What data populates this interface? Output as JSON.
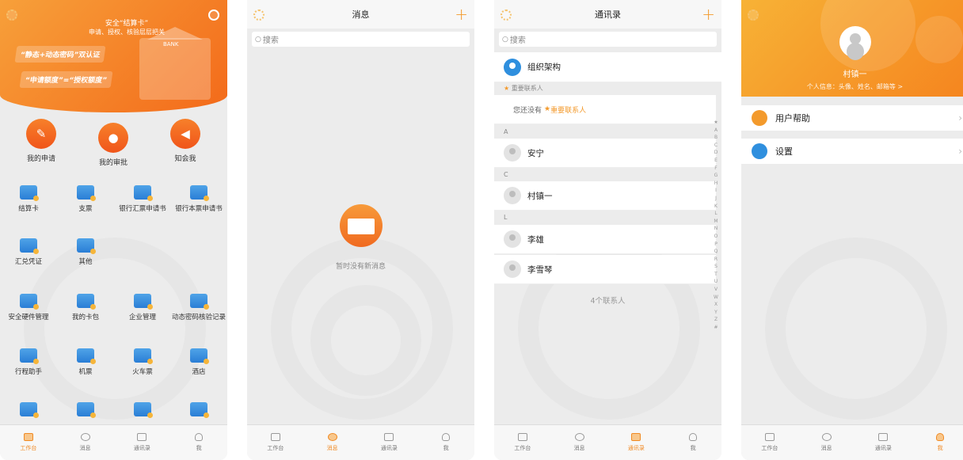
{
  "workbench": {
    "hero_line1": "安全“结算卡”",
    "hero_line2": "申请、授权、核验层层把关",
    "promo1": "“静态+动态密码”双认证",
    "promo2": "“申请额度”=“授权额度”",
    "bank_sign": "BANK",
    "quick_actions": [
      "我的申请",
      "我的审批",
      "知会我"
    ],
    "grid": [
      "结算卡",
      "支票",
      "银行汇票申请书",
      "银行本票申请书",
      "汇兑凭证",
      "其他",
      "安全硬件管理",
      "我的卡包",
      "企业管理",
      "动态密码核验记录",
      "行程助手",
      "机票",
      "火车票",
      "酒店"
    ]
  },
  "messages": {
    "title": "消息",
    "search_placeholder": "搜索",
    "empty_text": "暂时没有新消息"
  },
  "contacts": {
    "title": "通讯录",
    "search_placeholder": "搜索",
    "org_label": "组织架构",
    "important_header": "重要联系人",
    "no_important_prefix": "您还没有",
    "no_important_link": "重要联系人",
    "sections": [
      {
        "letter": "A",
        "names": [
          "安宁"
        ]
      },
      {
        "letter": "C",
        "names": [
          "村镇一"
        ]
      },
      {
        "letter": "L",
        "names": [
          "李雄",
          "李雪琴"
        ]
      }
    ],
    "count_text": "4个联系人",
    "index_letters": [
      "★",
      "A",
      "B",
      "C",
      "D",
      "E",
      "F",
      "G",
      "H",
      "I",
      "J",
      "K",
      "L",
      "M",
      "N",
      "O",
      "P",
      "Q",
      "R",
      "S",
      "T",
      "U",
      "V",
      "W",
      "X",
      "Y",
      "Z",
      "#"
    ]
  },
  "me": {
    "name": "村镇一",
    "subtitle": "个人信息：头像、姓名、邮箱等 >",
    "menu": [
      "用户帮助",
      "设置"
    ]
  },
  "tabbar": [
    "工作台",
    "消息",
    "通讯录",
    "我"
  ],
  "colors": {
    "accent": "#f39a2c",
    "hero_start": "#f7a03a",
    "hero_end": "#f36a1a",
    "grid_icon": "#2a7ed6"
  }
}
